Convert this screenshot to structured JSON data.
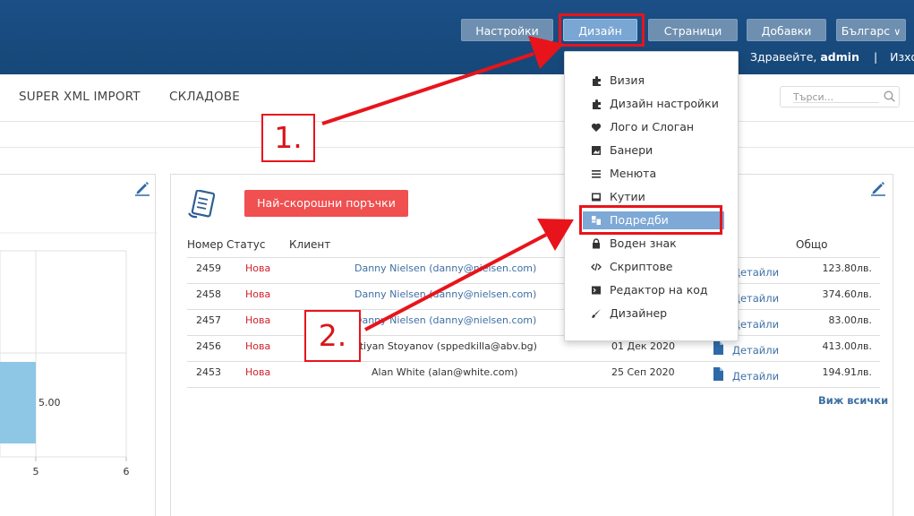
{
  "header": {
    "buttons": [
      {
        "label": "Настройки"
      },
      {
        "label": "Дизайн"
      },
      {
        "label": "Страници"
      },
      {
        "label": "Добавки"
      },
      {
        "label": "Българс"
      }
    ],
    "greeting_prefix": "Здравейте,",
    "username": "admin",
    "separator": "|",
    "logout": "Изход"
  },
  "subnav": {
    "items": [
      "SUPER XML IMPORT",
      "СКЛАДОВЕ"
    ],
    "search_placeholder": "Търси..."
  },
  "chart_data": {
    "type": "bar",
    "orientation": "horizontal",
    "values": [
      5.0
    ],
    "value_labels": [
      "5.00"
    ],
    "x_ticks": [
      "5",
      "6"
    ],
    "grid": true
  },
  "orders": {
    "title": "Най-скорошни поръчки",
    "columns": [
      "Номер",
      "Статус",
      "Клиент",
      "Общо"
    ],
    "rows": [
      {
        "number": "2459",
        "status": "Нова",
        "client": "Danny Nielsen (danny@nielsen.com)",
        "date": "",
        "details": "Детайли",
        "total": "123.80лв."
      },
      {
        "number": "2458",
        "status": "Нова",
        "client": "Danny Nielsen (danny@nielsen.com)",
        "date": "",
        "details": "Детайли",
        "total": "374.60лв."
      },
      {
        "number": "2457",
        "status": "Нова",
        "client": "Danny Nielsen (danny@nielsen.com)",
        "date": "",
        "details": "Детайли",
        "total": "83.00лв."
      },
      {
        "number": "2456",
        "status": "Нова",
        "client": "stiyan Stoyanov (sppedkilla@abv.bg)",
        "date": "01 Дек 2020",
        "details": "Детайли",
        "total": "413.00лв."
      },
      {
        "number": "2453",
        "status": "Нова",
        "client": "Alan White (alan@white.com)",
        "date": "25 Сеп 2020",
        "details": "Детайли",
        "total": "194.91лв."
      }
    ],
    "view_all": "Виж всички"
  },
  "dropdown": {
    "items": [
      {
        "label": "Визия",
        "icon": "puzzle-icon"
      },
      {
        "label": "Дизайн настройки",
        "icon": "puzzle-icon"
      },
      {
        "label": "Лого и Слоган",
        "icon": "heart-icon"
      },
      {
        "label": "Банери",
        "icon": "image-icon"
      },
      {
        "label": "Менюта",
        "icon": "list-icon"
      },
      {
        "label": "Кутии",
        "icon": "box-icon"
      },
      {
        "label": "Подредби",
        "icon": "layout-icon",
        "active": true
      },
      {
        "label": "Воден знак",
        "icon": "lock-icon"
      },
      {
        "label": "Скриптове",
        "icon": "code-icon"
      },
      {
        "label": "Редактор на код",
        "icon": "terminal-icon"
      },
      {
        "label": "Дизайнер",
        "icon": "brush-icon"
      }
    ]
  },
  "annotations": {
    "step1": "1.",
    "step2": "2.",
    "color": "#e8141b"
  },
  "colors": {
    "header_bg": "#164778",
    "accent": "#3f6fa3",
    "status_new": "#d0202a",
    "orders_title_bg": "#f05050",
    "bar_fill": "#8ec6e6"
  }
}
